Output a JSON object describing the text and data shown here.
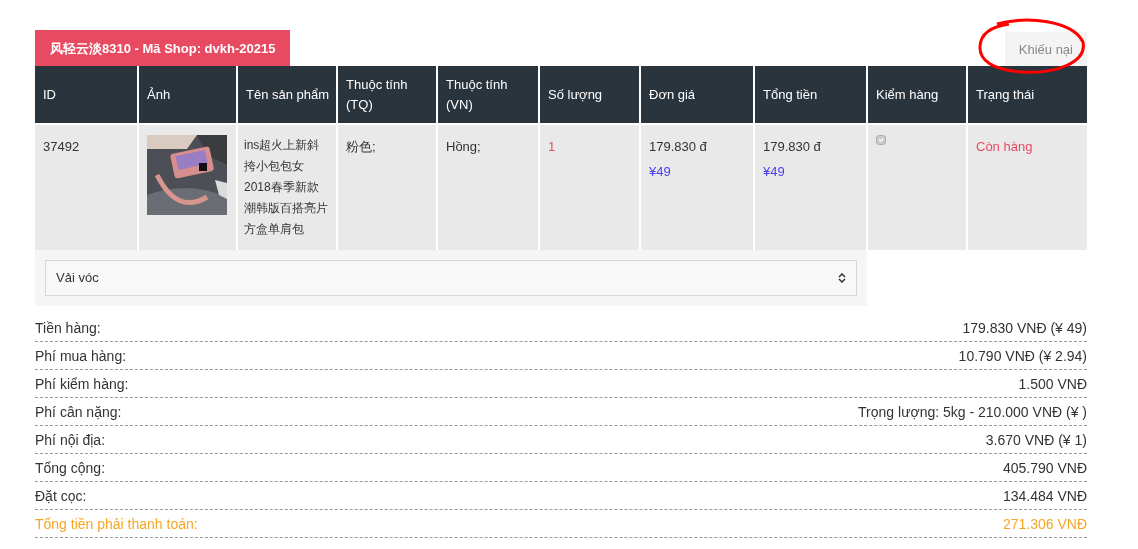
{
  "shop_tag": "风轻云淡8310 - Mã Shop: dvkh-20215",
  "complaint_button": {
    "label": "Khiếu nại",
    "highlighted": true
  },
  "table": {
    "columns": [
      "ID",
      "Ảnh",
      "Tên sản phẩm",
      "Thuộc tính (TQ)",
      "Thuộc tính (VN)",
      "Số lượng",
      "Đơn giá",
      "Tổng tiền",
      "Kiểm hàng",
      "Trạng thái"
    ],
    "rows": [
      {
        "id": "37492",
        "name": "ins超火上新斜挎小包包女2018春季新款潮韩版百搭亮片方盒单肩包",
        "attr_tq": "粉色;",
        "attr_vn": "Hồng;",
        "quantity": "1",
        "unit_price": "179.830 đ",
        "unit_price_cny": "¥49",
        "total": "179.830 đ",
        "total_cny": "¥49",
        "inspection": {
          "checked": true,
          "disabled": true
        },
        "status": "Còn hàng"
      }
    ]
  },
  "category_select": {
    "value": "Vải vóc"
  },
  "summary": [
    {
      "label": "Tiền hàng:",
      "value": "179.830 VNĐ (¥ 49)",
      "emphasis": false
    },
    {
      "label": "Phí mua hàng:",
      "value": "10.790 VNĐ (¥ 2.94)",
      "emphasis": false
    },
    {
      "label": "Phí kiểm hàng:",
      "value": "1.500 VNĐ",
      "emphasis": false
    },
    {
      "label": "Phí cân nặng:",
      "value": "Trọng lượng: 5kg - 210.000 VNĐ (¥ )",
      "emphasis": false
    },
    {
      "label": "Phí nội địa:",
      "value": "3.670 VNĐ (¥ 1)",
      "emphasis": false
    },
    {
      "label": "Tổng cộng:",
      "value": "405.790 VNĐ",
      "emphasis": false
    },
    {
      "label": "Đặt cọc:",
      "value": "134.484 VNĐ",
      "emphasis": false
    },
    {
      "label": "Tổng tiền phải thanh toán:",
      "value": "271.306 VNĐ",
      "emphasis": true
    }
  ]
}
